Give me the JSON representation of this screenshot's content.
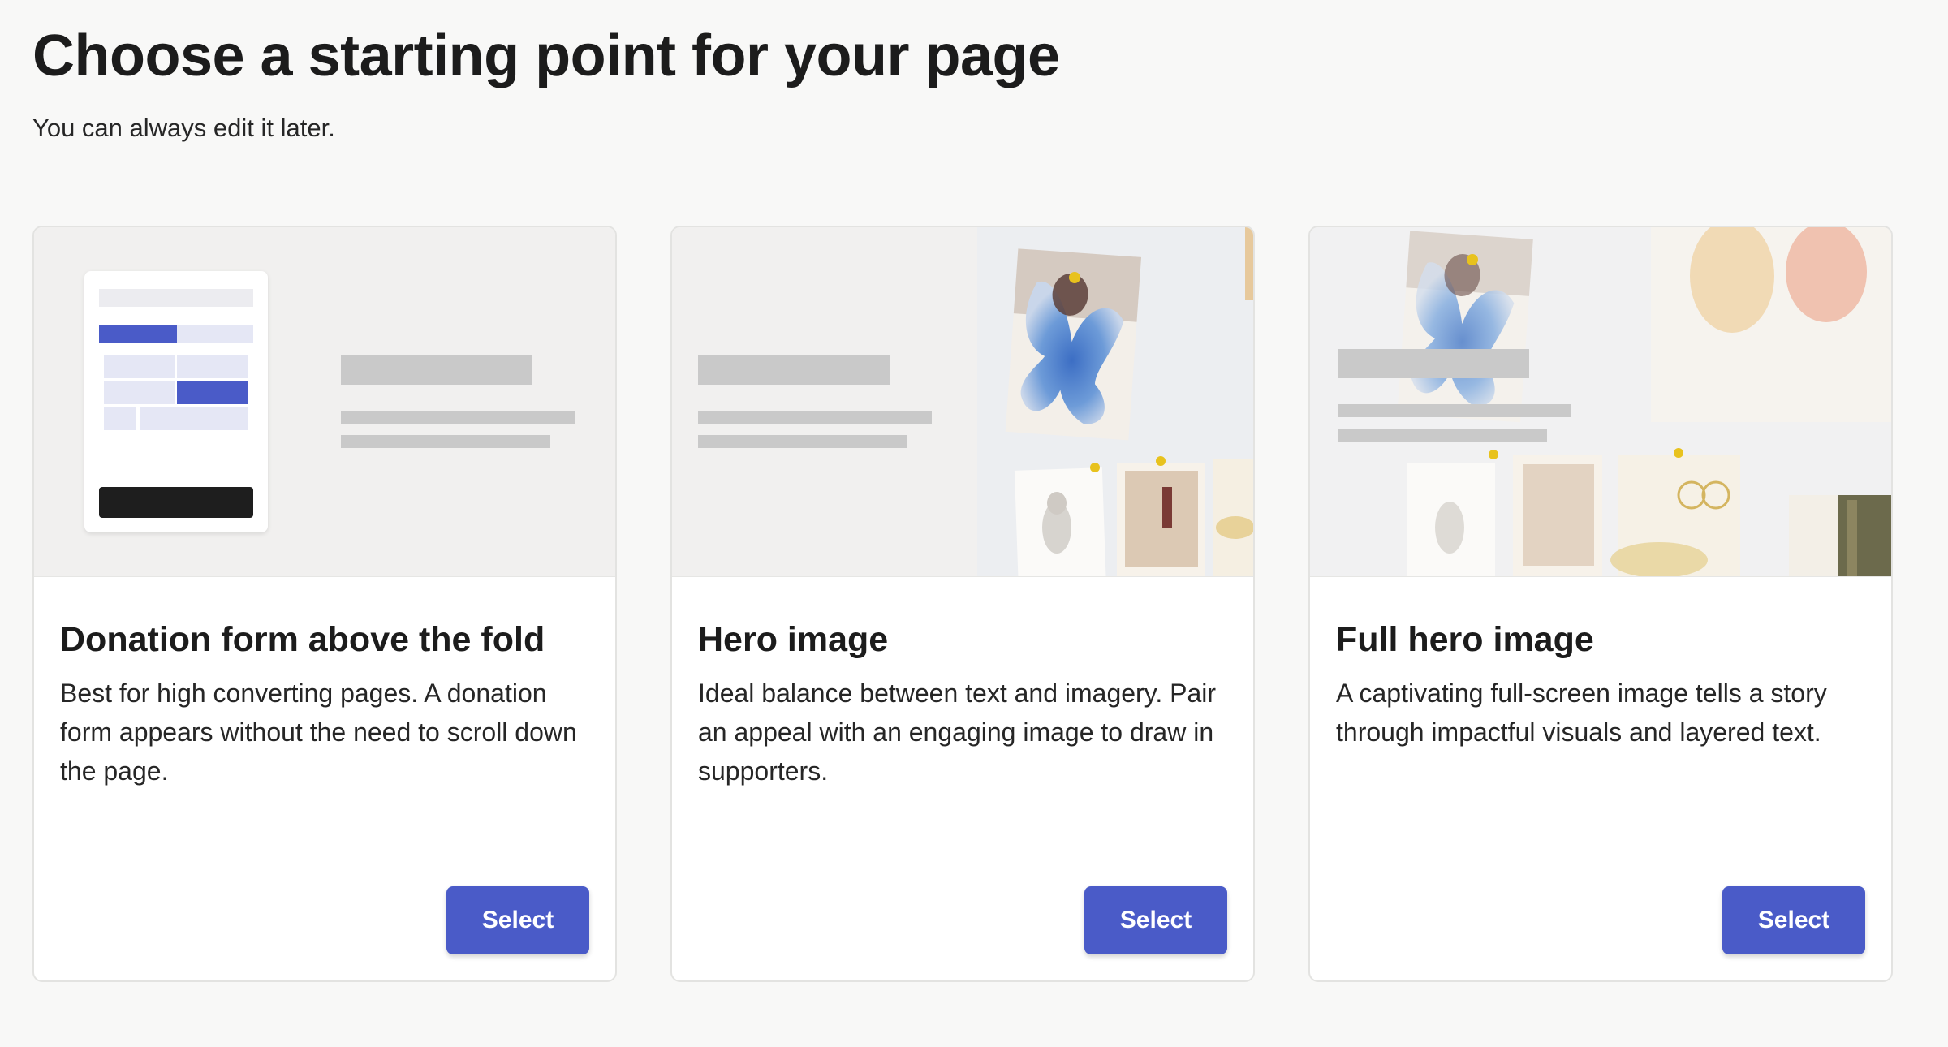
{
  "header": {
    "title": "Choose a starting point for your page",
    "subtitle": "You can always edit it later."
  },
  "cards": [
    {
      "title": "Donation form above the fold",
      "description": "Best for high converting pages. A donation form appears without the need to scroll down the page.",
      "button_label": "Select"
    },
    {
      "title": "Hero image",
      "description": "Ideal balance between text and imagery. Pair an appeal with an engaging image to draw in supporters.",
      "button_label": "Select"
    },
    {
      "title": "Full hero image",
      "description": "A captivating full-screen image tells a story through impactful visuals and layered text.",
      "button_label": "Select"
    }
  ],
  "colors": {
    "accent": "#4a5bc8",
    "background": "#f8f8f7",
    "placeholder": "#c9c9c9"
  }
}
